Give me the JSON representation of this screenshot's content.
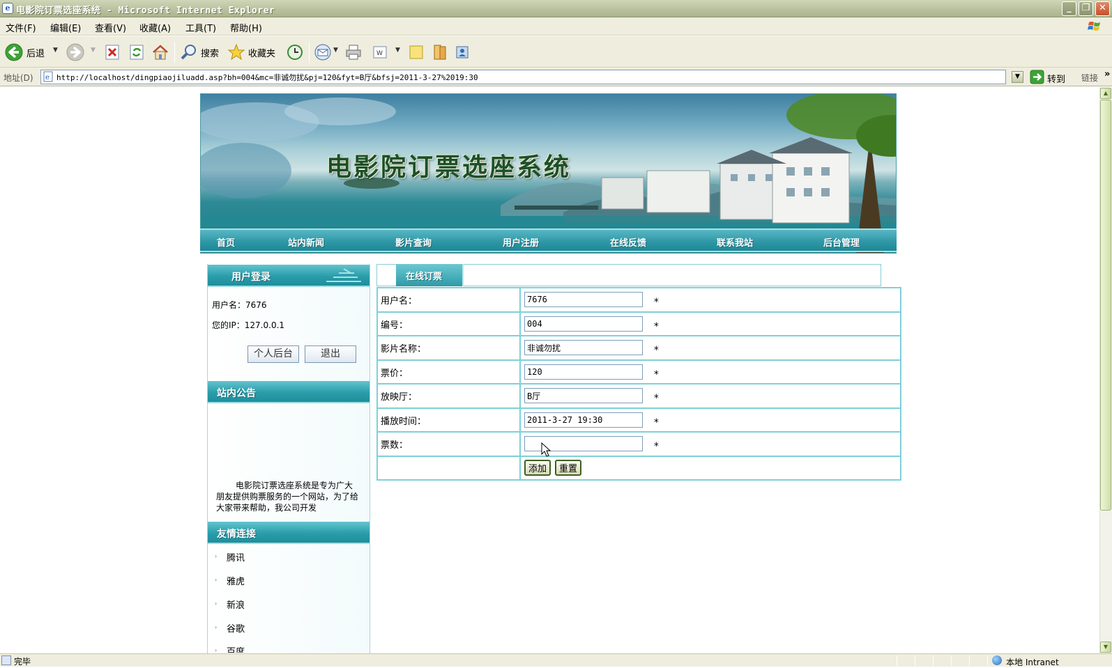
{
  "window": {
    "title": "电影院订票选座系统 - Microsoft Internet Explorer",
    "controls": [
      "_",
      "❐",
      "✕"
    ]
  },
  "menu": [
    "文件(F)",
    "编辑(E)",
    "查看(V)",
    "收藏(A)",
    "工具(T)",
    "帮助(H)"
  ],
  "toolbar": {
    "back_label": "后退",
    "search_label": "搜索",
    "favorites_label": "收藏夹"
  },
  "address": {
    "label": "地址(D)",
    "url": "http://localhost/dingpiaojiluadd.asp?bh=004&mc=非诚勿扰&pj=120&fyt=B厅&bfsj=2011-3-27%2019:30",
    "go_label": "转到",
    "links_label": "链接",
    "chevron": "»"
  },
  "banner": {
    "title": "电影院订票选座系统"
  },
  "nav": [
    "首页",
    "站内新闻",
    "影片查询",
    "用户注册",
    "在线反馈",
    "联系我站",
    "后台管理"
  ],
  "login_box": {
    "header": "用户登录",
    "username_line": "用户名：7676",
    "ip_line": "您的IP：127.0.0.1",
    "backend_button": "个人后台",
    "logout_button": "退出"
  },
  "notice": {
    "header": "站内公告",
    "text": "电影院订票选座系统是专为广大朋友提供购票服务的一个网站，为了给大家带来帮助，我公司开发"
  },
  "friend_links": {
    "header": "友情连接",
    "bullet": "›",
    "items": [
      "腾讯",
      "雅虎",
      "新浪",
      "谷歌",
      "百度"
    ]
  },
  "form": {
    "tab_label": "在线订票",
    "required_mark": "*",
    "rows": [
      {
        "label": "用户名：",
        "value": "7676"
      },
      {
        "label": "编号：",
        "value": "004"
      },
      {
        "label": "影片名称：",
        "value": "非诚勿扰"
      },
      {
        "label": "票价：",
        "value": "120"
      },
      {
        "label": "放映厅：",
        "value": "B厅"
      },
      {
        "label": "播放时间：",
        "value": "2011-3-27 19:30"
      },
      {
        "label": "票数：",
        "value": ""
      }
    ],
    "add_button": "添加",
    "reset_button": "重置"
  },
  "status": {
    "text": "完毕",
    "zone": "本地 Intranet"
  }
}
